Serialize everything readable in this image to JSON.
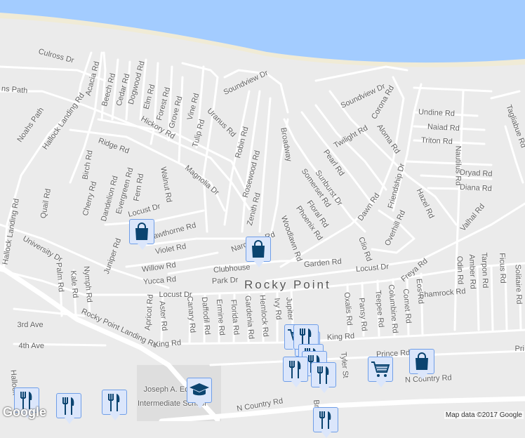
{
  "map": {
    "town_label": "Rocky Point",
    "attribution": "Map data ©2017 Google",
    "logo": "Google",
    "colors": {
      "water": "#a3ccff",
      "land": "#ebebeb",
      "road": "#ffffff",
      "marker_fill": "#dbe6fb",
      "marker_icon": "#0b4470",
      "beach": "#f0ebd6"
    },
    "street_labels": [
      "Culross Dr",
      "Acacia Rd",
      "Beech Rd",
      "Cedar Rd",
      "Dogwood Rd",
      "Elm Rd",
      "Forest Rd",
      "Grove Rd",
      "Vine Rd",
      "Tulip Rd",
      "Uranus Rd",
      "Soundview Dr",
      "Robin Rd",
      "Rosewood Rd",
      "Zenith Rd",
      "Hickory Rd",
      "Ridge Rd",
      "Magnolia Dr",
      "Hallock Landing Rd",
      "Noahs Path",
      "ns Path",
      "Birch Rd",
      "Cherry Rd",
      "Dandelion Rd",
      "Evergreen Rd",
      "Fern Rd",
      "Walnut Rd",
      "Quail Rd",
      "Locust Dr",
      "Hallock Landing Rd",
      "University Dr",
      "Juniper Rd",
      "Hawthorne Rd",
      "Violet Rd",
      "Willow Rd",
      "Yucca Rd",
      "Narcissus Rd",
      "Clubhouse",
      "Park Dr",
      "Locust Dr",
      "Broadway",
      "Pearl Rd",
      "Sunburst Dr",
      "Somerset Rd",
      "Floral Rd",
      "Phoenix Rd",
      "Woodlawn Rd",
      "Twilight Rd",
      "Soundview Dr",
      "Corona Rd",
      "Aloma Rd",
      "Undine Rd",
      "Naiad Rd",
      "Triton Rd",
      "Dryad Rd",
      "Diana Rd",
      "Nautilus Rd",
      "Tagliabue Rd",
      "Dawn Rd",
      "Friendship Dr",
      "Hazel Rd",
      "Overhill Rd",
      "Valhal Rd",
      "Clio Rd",
      "Garden Rd",
      "Locust Dr",
      "Freya Rd",
      "Odin Rd",
      "Amber Rd",
      "Tarpon Rd",
      "Ficus Rd",
      "Solitaire Rd",
      "Shamrock Rd",
      "Eos Rd",
      "Oxalis Rd",
      "Pansy Rd",
      "Teepee Rd",
      "Columbine Rd",
      "Comet Rd",
      "Palm Rd",
      "Kale Rd",
      "Nymph Rd",
      "Apricot Rd",
      "Aster Rd",
      "Canary Rd",
      "Daffodil Rd",
      "Ermine Rd",
      "Florida Rd",
      "Gardenia Rd",
      "Hemlock Rd",
      "Ivy Rd",
      "Jupiter",
      "3rd Ave",
      "4th Ave",
      "Rocky Point Landing Rd",
      "King Rd",
      "King Rd",
      "Prince Rd",
      "Tyler St",
      "N Country Rd",
      "N Country Rd",
      "Pri",
      "Hallock",
      "Joseph A. Edgar",
      "Intermediate School",
      "Br"
    ],
    "markers": [
      {
        "type": "shopping-bag"
      },
      {
        "type": "shopping-bag"
      },
      {
        "type": "shopping-bag"
      },
      {
        "type": "shopping-cart"
      },
      {
        "type": "shopping-cart"
      },
      {
        "type": "shopping-cart"
      },
      {
        "type": "restaurant"
      },
      {
        "type": "restaurant"
      },
      {
        "type": "restaurant"
      },
      {
        "type": "restaurant"
      },
      {
        "type": "restaurant"
      },
      {
        "type": "restaurant"
      },
      {
        "type": "restaurant"
      },
      {
        "type": "restaurant"
      },
      {
        "type": "restaurant"
      },
      {
        "type": "school"
      }
    ]
  }
}
